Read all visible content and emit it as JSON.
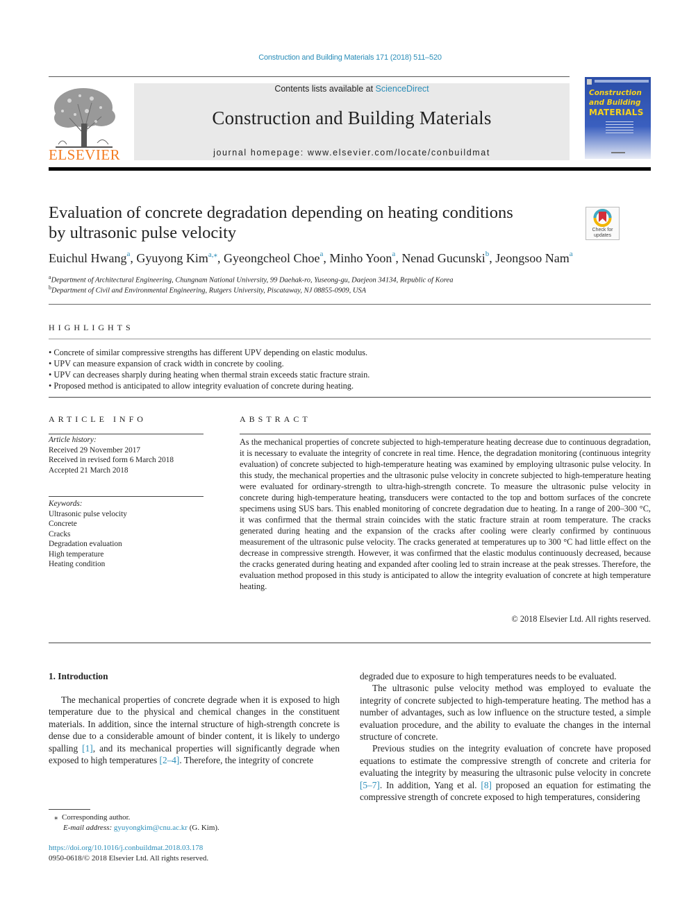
{
  "running_head": "Construction and Building Materials 171 (2018) 511–520",
  "masthead": {
    "contents_prefix": "Contents lists available at ",
    "contents_link": "ScienceDirect",
    "journal_title": "Construction and Building Materials",
    "homepage": "journal homepage: www.elsevier.com/locate/conbuildmat",
    "publisher_logo_text": "ELSEVIER",
    "cover": {
      "line1": "Construction",
      "line2": "and Building",
      "line3": "MATERIALS"
    },
    "brand_color": "#f47b20",
    "cover_color": "#2b4ea8",
    "link_color": "#2a8db8"
  },
  "crossmark": {
    "label_line1": "Check for",
    "label_line2": "updates"
  },
  "article": {
    "title_line1": "Evaluation of concrete degradation depending on heating conditions",
    "title_line2": "by ultrasonic pulse velocity",
    "authors": [
      {
        "name": "Euichul Hwang",
        "sup": "a",
        "sep": ", "
      },
      {
        "name": "Gyuyong Kim",
        "sup": "a,⁎",
        "sep": ", "
      },
      {
        "name": "Gyeongcheol Choe",
        "sup": "a",
        "sep": ", "
      },
      {
        "name": "Minho Yoon",
        "sup": "a",
        "sep": ", "
      },
      {
        "name": "Nenad Gucunski",
        "sup": "b",
        "sep": ", "
      },
      {
        "name": "Jeongsoo Nam",
        "sup": "a",
        "sep": ""
      }
    ],
    "affiliations": [
      {
        "mark": "a",
        "text": "Department of Architectural Engineering, Chungnam National University, 99 Daehak-ro, Yuseong-gu, Daejeon 34134, Republic of Korea"
      },
      {
        "mark": "b",
        "text": "Department of Civil and Environmental Engineering, Rutgers University, Piscataway, NJ 08855-0909, USA"
      }
    ]
  },
  "highlights": {
    "heading": "HIGHLIGHTS",
    "items": [
      "• Concrete of similar compressive strengths has different UPV depending on elastic modulus.",
      "• UPV can measure expansion of crack width in concrete by cooling.",
      "• UPV can decreases sharply during heating when thermal strain exceeds static fracture strain.",
      "• Proposed method is anticipated to allow integrity evaluation of concrete during heating."
    ]
  },
  "article_info": {
    "heading": "ARTICLE INFO",
    "history_label": "Article history:",
    "history": [
      "Received 29 November 2017",
      "Received in revised form 6 March 2018",
      "Accepted 21 March 2018"
    ],
    "keywords_label": "Keywords:",
    "keywords": [
      "Ultrasonic pulse velocity",
      "Concrete",
      "Cracks",
      "Degradation evaluation",
      "High temperature",
      "Heating condition"
    ]
  },
  "abstract": {
    "heading": "ABSTRACT",
    "text": "As the mechanical properties of concrete subjected to high-temperature heating decrease due to continuous degradation, it is necessary to evaluate the integrity of concrete in real time. Hence, the degradation monitoring (continuous integrity evaluation) of concrete subjected to high-temperature heating was examined by employing ultrasonic pulse velocity. In this study, the mechanical properties and the ultrasonic pulse velocity in concrete subjected to high-temperature heating were evaluated for ordinary-strength to ultra-high-strength concrete. To measure the ultrasonic pulse velocity in concrete during high-temperature heating, transducers were contacted to the top and bottom surfaces of the concrete specimens using SUS bars. This enabled monitoring of concrete degradation due to heating. In a range of 200–300 °C, it was confirmed that the thermal strain coincides with the static fracture strain at room temperature. The cracks generated during heating and the expansion of the cracks after cooling were clearly confirmed by continuous measurement of the ultrasonic pulse velocity. The cracks generated at temperatures up to 300 °C had little effect on the decrease in compressive strength. However, it was confirmed that the elastic modulus continuously decreased, because the cracks generated during heating and expanded after cooling led to strain increase at the peak stresses. Therefore, the evaluation method proposed in this study is anticipated to allow the integrity evaluation of concrete at high temperature heating.",
    "copyright": "© 2018 Elsevier Ltd. All rights reserved."
  },
  "introduction": {
    "heading": "1. Introduction",
    "left_col": {
      "p1_a": "The mechanical properties of concrete degrade when it is exposed to high temperature due to the physical and chemical changes in the constituent materials. In addition, since the internal structure of high-strength concrete is dense due to a considerable amount of binder content, it is likely to undergo spalling ",
      "ref1": "[1]",
      "p1_b": ", and its mechanical properties will significantly degrade when exposed to high temperatures ",
      "ref2": "[2–4]",
      "p1_c": ". Therefore, the integrity of concrete"
    },
    "right_col": {
      "p1": "degraded due to exposure to high temperatures needs to be evaluated.",
      "p2": "The ultrasonic pulse velocity method was employed to evaluate the integrity of concrete subjected to high-temperature heating. The method has a number of advantages, such as low influence on the structure tested, a simple evaluation procedure, and the ability to evaluate the changes in the internal structure of concrete.",
      "p3_a": "Previous studies on the integrity evaluation of concrete have proposed equations to estimate the compressive strength of concrete and criteria for evaluating the integrity by measuring the ultrasonic pulse velocity in concrete ",
      "ref3": "[5–7]",
      "p3_b": ". In addition, Yang et al. ",
      "ref4": "[8]",
      "p3_c": " proposed an equation for estimating the compressive strength of concrete exposed to high temperatures, considering"
    }
  },
  "footnotes": {
    "corresponding_mark": "⁎",
    "corresponding": "Corresponding author.",
    "email_label": "E-mail address: ",
    "email": "gyuyongkim@cnu.ac.kr",
    "email_suffix": " (G. Kim).",
    "doi": "https://doi.org/10.1016/j.conbuildmat.2018.03.178",
    "issn": "0950-0618/© 2018 Elsevier Ltd. All rights reserved."
  }
}
